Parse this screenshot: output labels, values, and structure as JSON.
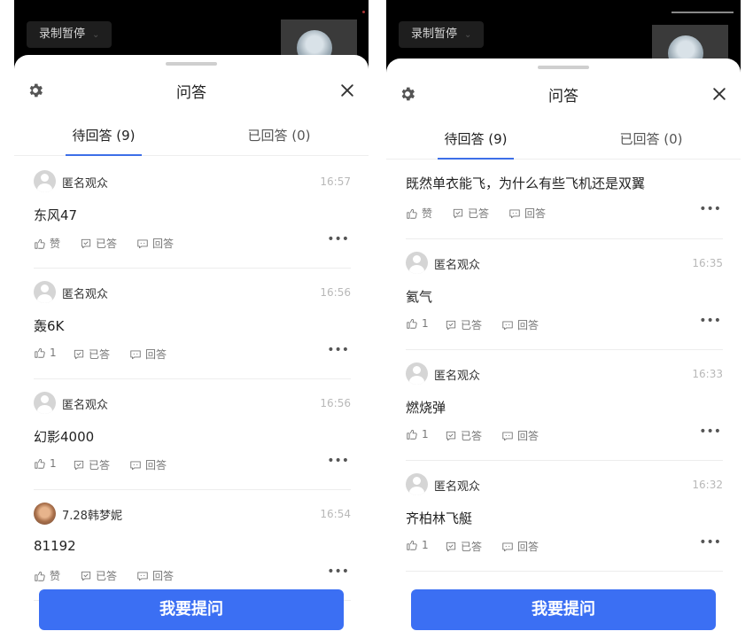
{
  "left": {
    "record_pill": "录制暂停",
    "title": "问答",
    "tabs": {
      "pending": "待回答 (9)",
      "answered": "已回答 (0)"
    },
    "items": [
      {
        "user": "匿名观众",
        "time": "16:57",
        "content": "东风47",
        "likes": "赞",
        "done": "已答",
        "reply": "回答"
      },
      {
        "user": "匿名观众",
        "time": "16:56",
        "content": "轰6K",
        "likes": "1",
        "done": "已答",
        "reply": "回答"
      },
      {
        "user": "匿名观众",
        "time": "16:56",
        "content": "幻影4000",
        "likes": "1",
        "done": "已答",
        "reply": "回答"
      },
      {
        "user": "7.28韩梦妮",
        "time": "16:54",
        "content": "81192",
        "likes": "赞",
        "done": "已答",
        "reply": "回答"
      }
    ],
    "ask_button": "我要提问"
  },
  "right": {
    "record_pill": "录制暂停",
    "title": "问答",
    "tabs": {
      "pending": "待回答 (9)",
      "answered": "已回答 (0)"
    },
    "items": [
      {
        "content": "既然单衣能飞，为什么有些飞机还是双翼",
        "likes": "赞",
        "done": "已答",
        "reply": "回答"
      },
      {
        "user": "匿名观众",
        "time": "16:35",
        "content": "氦气",
        "likes": "1",
        "done": "已答",
        "reply": "回答"
      },
      {
        "user": "匿名观众",
        "time": "16:33",
        "content": "燃烧弹",
        "likes": "1",
        "done": "已答",
        "reply": "回答"
      },
      {
        "user": "匿名观众",
        "time": "16:32",
        "content": "齐柏林飞艇",
        "likes": "1",
        "done": "已答",
        "reply": "回答"
      }
    ],
    "ask_button": "我要提问"
  },
  "colors": {
    "accent": "#3b6ff3",
    "tab_underline": "#3d6fe8",
    "muted": "#b8b8b8"
  },
  "icons": [
    "gear-icon",
    "close-icon",
    "thumbs-up-icon",
    "check-box-icon",
    "comment-icon",
    "more-icon",
    "anonymous-avatar-icon"
  ]
}
